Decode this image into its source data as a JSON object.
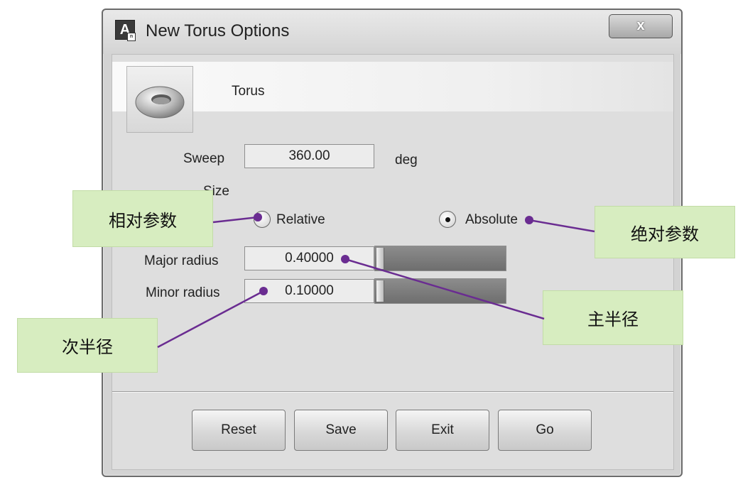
{
  "window": {
    "title": "New Torus Options",
    "close_glyph": "x",
    "app_icon_letter": "A",
    "app_icon_sub": "n"
  },
  "header": {
    "label": "Torus",
    "icon": "torus-icon"
  },
  "sweep": {
    "label": "Sweep",
    "value": "360.00",
    "unit": "deg"
  },
  "size": {
    "label": "Size",
    "relative_label": "Relative",
    "absolute_label": "Absolute",
    "selected": "Absolute"
  },
  "major_radius": {
    "label": "Major radius",
    "value": "0.40000"
  },
  "minor_radius": {
    "label": "Minor radius",
    "value": "0.10000"
  },
  "buttons": {
    "reset": "Reset",
    "save": "Save",
    "exit": "Exit",
    "go": "Go"
  },
  "annotations": {
    "relative": "相对参数",
    "absolute": "绝对参数",
    "major": "主半径",
    "minor": "次半径",
    "line_color": "#6a2c91",
    "box_color": "#d7edc0"
  }
}
